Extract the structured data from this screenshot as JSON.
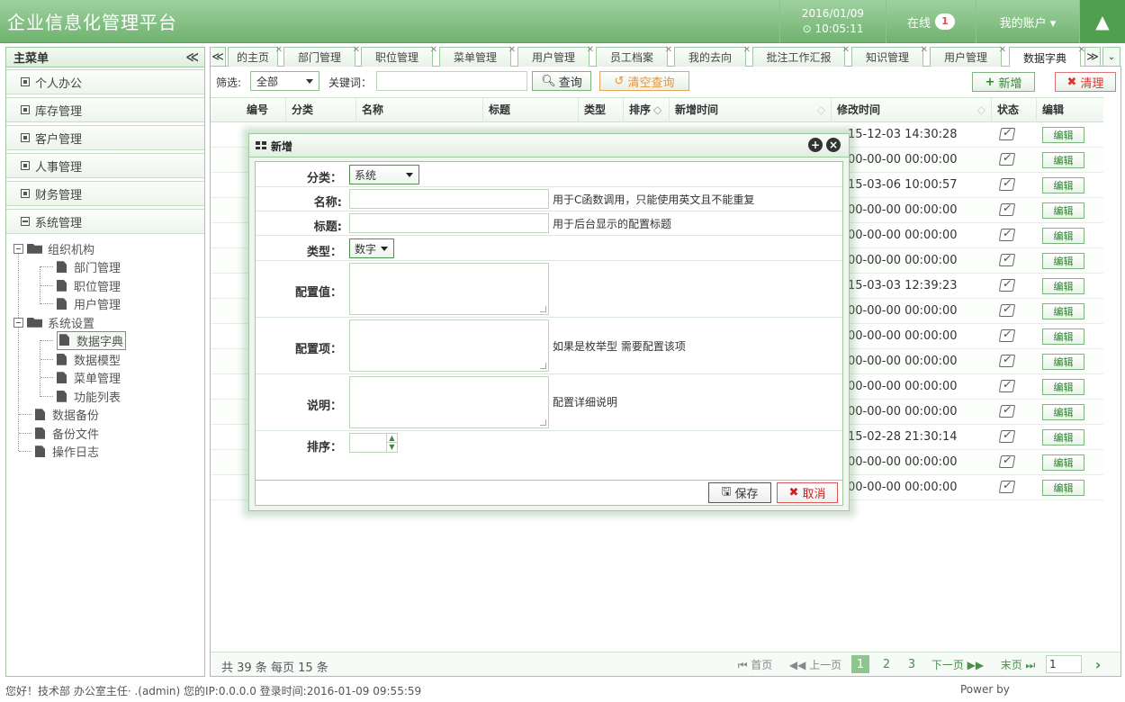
{
  "header": {
    "title": "企业信息化管理平台",
    "date": "2016/01/09",
    "time": "⊙ 10:05:11",
    "online_label": "在线",
    "online_count": "1",
    "account_label": "我的账户 ▾",
    "tree_icon": "tree-icon"
  },
  "sidebar": {
    "title": "主菜单",
    "collapse": "≪",
    "sections": [
      "个人办公",
      "库存管理",
      "客户管理",
      "人事管理",
      "财务管理",
      "系统管理"
    ],
    "tree": {
      "org": "组织机构",
      "org_children": [
        "部门管理",
        "职位管理",
        "用户管理"
      ],
      "settings": "系统设置",
      "settings_children": [
        "数据字典",
        "数据模型",
        "菜单管理",
        "功能列表"
      ],
      "others": [
        "数据备份",
        "备份文件",
        "操作日志"
      ]
    }
  },
  "tabs": {
    "prev": "≪",
    "next": "≫",
    "menu": "≫",
    "items": [
      "的主页",
      "部门管理",
      "职位管理",
      "菜单管理",
      "用户管理",
      "员工档案",
      "我的去向",
      "批注工作汇报",
      "知识管理",
      "用户管理",
      "数据字典"
    ],
    "close": "✕"
  },
  "toolbar": {
    "filter_label": "筛选:",
    "filter_value": "全部",
    "keyword_label": "关键词：",
    "search": "查询",
    "clear_search": "清空查询",
    "add": "新增",
    "clean": "清理"
  },
  "grid": {
    "columns": [
      "编号",
      "分类",
      "名称",
      "标题",
      "类型",
      "排序",
      "新增时间",
      "修改时间",
      "状态",
      "编辑"
    ],
    "rows": [
      "15-12-03 14:30:28",
      "00-00-00 00:00:00",
      "15-03-06 10:00:57",
      "00-00-00 00:00:00",
      "00-00-00 00:00:00",
      "00-00-00 00:00:00",
      "15-03-03 12:39:23",
      "00-00-00 00:00:00",
      "00-00-00 00:00:00",
      "00-00-00 00:00:00",
      "00-00-00 00:00:00",
      "00-00-00 00:00:00",
      "15-02-28 21:30:14",
      "00-00-00 00:00:00",
      "00-00-00 00:00:00"
    ],
    "edit_label": "编辑"
  },
  "pager": {
    "info": "共 39 条 每页 15 条",
    "first": "⏮ 首页",
    "prev": "◀◀ 上一页",
    "pages": [
      "1",
      "2",
      "3"
    ],
    "next": "下一页 ▶▶",
    "last": "末页 ⏭",
    "page_input": "1",
    "go": "›"
  },
  "status": {
    "left": "您好！技术部 办公室主任·         .(admin) 您的IP:0.0.0.0 登录时间:2016-01-09 09:55:59",
    "right": "Power by"
  },
  "dialog": {
    "title": "新增",
    "category_label": "分类：",
    "category_value": "系统",
    "name_label": "名称:",
    "name_hint": "用于C函数调用，只能使用英文且不能重复",
    "title_label": "标题:",
    "title_hint": "用于后台显示的配置标题",
    "type_label": "类型：",
    "type_value": "数字",
    "value_label": "配置值：",
    "items_label": "配置项：",
    "items_hint": "如果是枚举型 需要配置该项",
    "desc_label": "说明：",
    "desc_hint": "配置详细说明",
    "sort_label": "排序：",
    "save": "保存",
    "cancel": "取消"
  }
}
